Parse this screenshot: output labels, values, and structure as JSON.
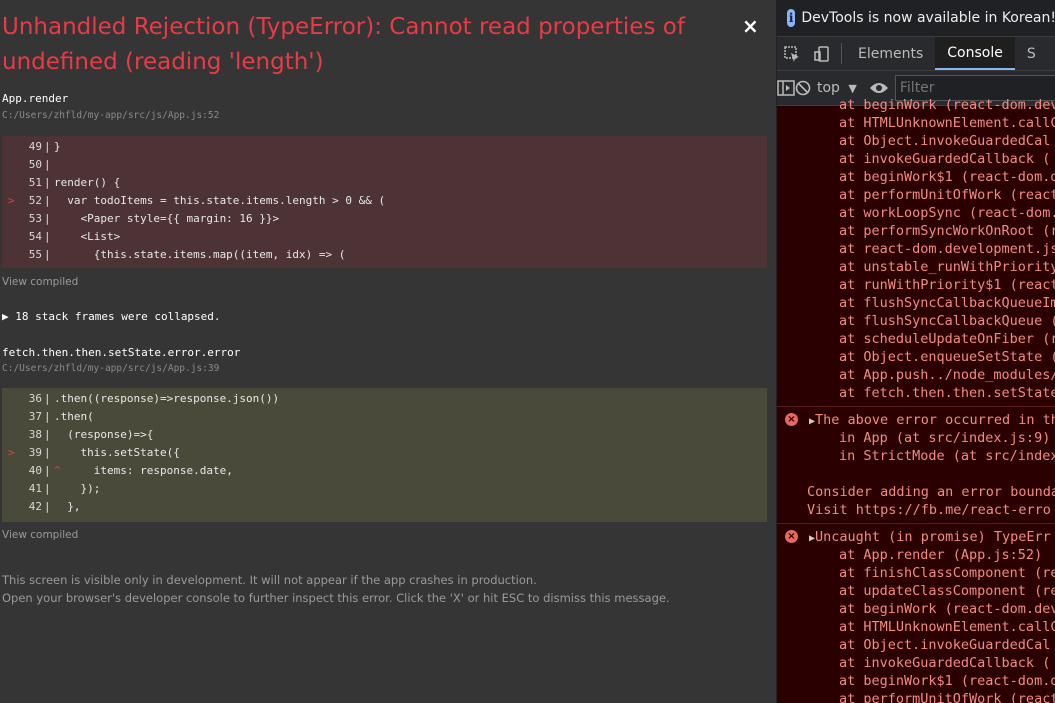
{
  "overlay": {
    "title": "Unhandled Rejection (TypeError): Cannot read properties of undefined (reading 'length')",
    "close_label": "×",
    "frame1": {
      "name": "App.render",
      "path": "C:/Users/zhfld/my-app/src/js/App.js:52",
      "lines": [
        {
          "num": "49",
          "mark": "",
          "text": "}"
        },
        {
          "num": "50",
          "mark": "",
          "text": ""
        },
        {
          "num": "51",
          "mark": "",
          "text": "render() {"
        },
        {
          "num": "52",
          "mark": ">",
          "text": "  var todoItems = this.state.items.length > 0 && ("
        },
        {
          "num": "53",
          "mark": "",
          "text": "    <Paper style={{ margin: 16 }}>"
        },
        {
          "num": "54",
          "mark": "",
          "text": "    <List>"
        },
        {
          "num": "55",
          "mark": "",
          "text": "      {this.state.items.map((item, idx) => ("
        }
      ],
      "view_compiled": "View compiled"
    },
    "collapsed": "18 stack frames were collapsed.",
    "frame2": {
      "name": "fetch.then.then.setState.error.error",
      "path": "C:/Users/zhfld/my-app/src/js/App.js:39",
      "lines": [
        {
          "num": "36",
          "mark": "",
          "text": ".then((response)=>response.json())"
        },
        {
          "num": "37",
          "mark": "",
          "text": ".then("
        },
        {
          "num": "38",
          "mark": "",
          "text": "  (response)=>{"
        },
        {
          "num": "39",
          "mark": ">",
          "text": "    this.setState({"
        },
        {
          "num": "40",
          "mark": "",
          "text": "^     items: response.date,"
        },
        {
          "num": "41",
          "mark": "",
          "text": "    });"
        },
        {
          "num": "42",
          "mark": "",
          "text": "  },"
        }
      ],
      "view_compiled": "View compiled"
    },
    "footer_line1": "This screen is visible only in development. It will not appear if the app crashes in production.",
    "footer_line2": "Open your browser's developer console to further inspect this error.  Click the 'X' or hit ESC to dismiss this message."
  },
  "devtools": {
    "info": "DevTools is now available in Korean!",
    "tabs": [
      "Elements",
      "Console",
      "S"
    ],
    "active_tab": "Console",
    "context": "top",
    "filter_placeholder": "Filter",
    "stack1": [
      "at beginWork (react-dom.dev",
      "at HTMLUnknownElement.callC",
      "at Object.invokeGuardedCal",
      "at invokeGuardedCallback (",
      "at beginWork$1 (react-dom.d",
      "at performUnitOfWork (react",
      "at workLoopSync (react-dom.",
      "at performSyncWorkOnRoot (r",
      "at react-dom.development.js",
      "at unstable_runWithPriority",
      "at runWithPriority$1 (react",
      "at flushSyncCallbackQueueIm",
      "at flushSyncCallbackQueue (",
      "at scheduleUpdateOnFiber (r",
      "at Object.enqueueSetState (",
      "at App.push../node_modules/",
      "at fetch.then.then.setState"
    ],
    "entry2_head": "The above error occurred in the",
    "entry2_lines": [
      "in App (at src/index.js:9)",
      "in StrictMode (at src/index"
    ],
    "entry2_tail": [
      "Consider adding an error bounda",
      "Visit https://fb.me/react-erro"
    ],
    "entry3_head": "Uncaught (in promise) TypeErr",
    "stack3": [
      "at App.render (App.js:52)",
      "at finishClassComponent (re",
      "at updateClassComponent (re",
      "at beginWork (react-dom.dev",
      "at HTMLUnknownElement.callC",
      "at Object.invokeGuardedCal",
      "at invokeGuardedCallback (",
      "at beginWork$1 (react-dom.d",
      "at performUnitOfWork (react"
    ]
  }
}
